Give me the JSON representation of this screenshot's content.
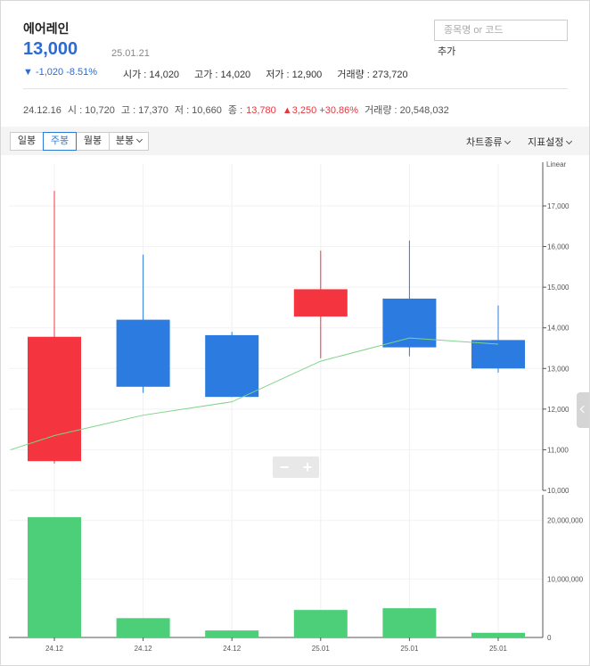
{
  "stock": {
    "name": "에어레인",
    "price": "13,000",
    "date": "25.01.21",
    "change": "▼ -1,020 -8.51%",
    "open": "시가 : 14,020",
    "high": "고가 : 14,020",
    "low": "저가 : 12,900",
    "volume": "거래량 : 273,720"
  },
  "search": {
    "placeholder": "종목명 or 코드",
    "add_label": "추가"
  },
  "period": {
    "date": "24.12.16",
    "open": "시 : 10,720",
    "high": "고 : 17,370",
    "low": "저 : 10,660",
    "close_label": "종 :",
    "close": "13,780",
    "change": "▲3,250 +30.86%",
    "volume": "거래량 : 20,548,032"
  },
  "toolbar": {
    "tabs": [
      "일봉",
      "주봉",
      "월봉",
      "분봉"
    ],
    "chart_type": "차트종류",
    "indicator": "지표설정"
  },
  "colors": {
    "up": "#f4343f",
    "down": "#2b7be0",
    "volume": "#4ccf78",
    "ma": "#7fd48a",
    "accent": "#2b6bd6"
  },
  "chart_data": {
    "type": "candlestick",
    "scale_label": "Linear",
    "categories": [
      "24.12",
      "24.12",
      "24.12",
      "25.01",
      "25.01",
      "25.01"
    ],
    "candles": [
      {
        "open": 10720,
        "high": 17370,
        "low": 10660,
        "close": 13780
      },
      {
        "open": 14200,
        "high": 15800,
        "low": 12400,
        "close": 12550
      },
      {
        "open": 13820,
        "high": 13900,
        "low": 12300,
        "close": 12300
      },
      {
        "open": 14280,
        "high": 15900,
        "low": 13250,
        "close": 14950
      },
      {
        "open": 14720,
        "high": 16150,
        "low": 13300,
        "close": 13520
      },
      {
        "open": 13700,
        "high": 14550,
        "low": 12900,
        "close": 13000
      }
    ],
    "ma": [
      11000,
      11350,
      11850,
      12180,
      13180,
      13750,
      13600
    ],
    "price_ylim": [
      10000,
      17600
    ],
    "price_ticks": [
      10000,
      11000,
      12000,
      13000,
      14000,
      15000,
      16000,
      17000
    ],
    "volume": [
      20548032,
      3300000,
      1200000,
      4700000,
      5000000,
      800000
    ],
    "volume_ylim": [
      0,
      26000000
    ],
    "volume_ticks": [
      "0",
      "10,000,000",
      "20,000,000"
    ]
  }
}
